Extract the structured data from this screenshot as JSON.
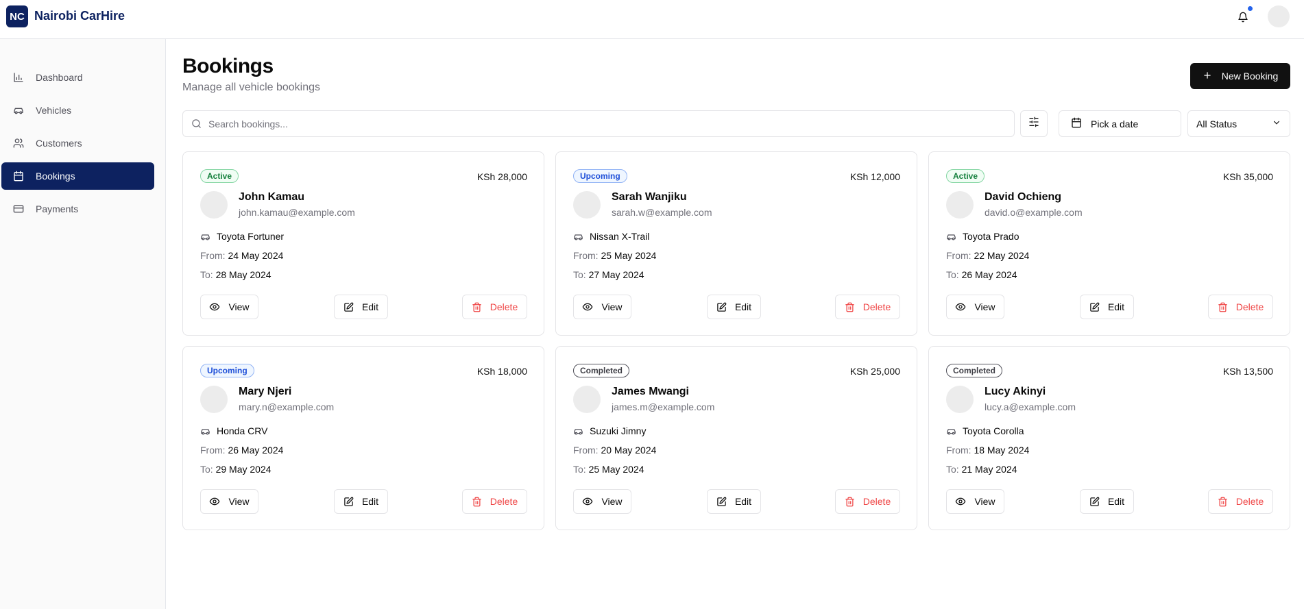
{
  "app": {
    "logo_initials": "NC",
    "name": "Nairobi CarHire"
  },
  "header_icons": {
    "notifications": "bell-icon",
    "user": "avatar"
  },
  "sidebar": {
    "items": [
      {
        "label": "Dashboard",
        "icon": "bar-chart-icon",
        "active": false
      },
      {
        "label": "Vehicles",
        "icon": "car-icon",
        "active": false
      },
      {
        "label": "Customers",
        "icon": "users-icon",
        "active": false
      },
      {
        "label": "Bookings",
        "icon": "calendar-icon",
        "active": true
      },
      {
        "label": "Payments",
        "icon": "credit-card-icon",
        "active": false
      }
    ]
  },
  "page": {
    "title": "Bookings",
    "subtitle": "Manage all vehicle bookings",
    "new_button": "New Booking"
  },
  "filters": {
    "search_placeholder": "Search bookings...",
    "date_label": "Pick a date",
    "status_value": "All Status"
  },
  "labels": {
    "from": "From:",
    "to": "To:",
    "view": "View",
    "edit": "Edit",
    "delete": "Delete"
  },
  "bookings": [
    {
      "status": "Active",
      "status_key": "active",
      "price": "KSh 28,000",
      "name": "John Kamau",
      "email": "john.kamau@example.com",
      "vehicle": "Toyota Fortuner",
      "from": "24 May 2024",
      "to": "28 May 2024"
    },
    {
      "status": "Upcoming",
      "status_key": "upcoming",
      "price": "KSh 12,000",
      "name": "Sarah Wanjiku",
      "email": "sarah.w@example.com",
      "vehicle": "Nissan X-Trail",
      "from": "25 May 2024",
      "to": "27 May 2024"
    },
    {
      "status": "Active",
      "status_key": "active",
      "price": "KSh 35,000",
      "name": "David Ochieng",
      "email": "david.o@example.com",
      "vehicle": "Toyota Prado",
      "from": "22 May 2024",
      "to": "26 May 2024"
    },
    {
      "status": "Upcoming",
      "status_key": "upcoming",
      "price": "KSh 18,000",
      "name": "Mary Njeri",
      "email": "mary.n@example.com",
      "vehicle": "Honda CRV",
      "from": "26 May 2024",
      "to": "29 May 2024"
    },
    {
      "status": "Completed",
      "status_key": "completed",
      "price": "KSh 25,000",
      "name": "James Mwangi",
      "email": "james.m@example.com",
      "vehicle": "Suzuki Jimny",
      "from": "20 May 2024",
      "to": "25 May 2024"
    },
    {
      "status": "Completed",
      "status_key": "completed",
      "price": "KSh 13,500",
      "name": "Lucy Akinyi",
      "email": "lucy.a@example.com",
      "vehicle": "Toyota Corolla",
      "from": "18 May 2024",
      "to": "21 May 2024"
    }
  ],
  "colors": {
    "brand": "#0d2260",
    "active_badge": "#15803d",
    "upcoming_badge": "#1d4ed8",
    "delete": "#ef4444",
    "notification_dot": "#2563eb"
  }
}
